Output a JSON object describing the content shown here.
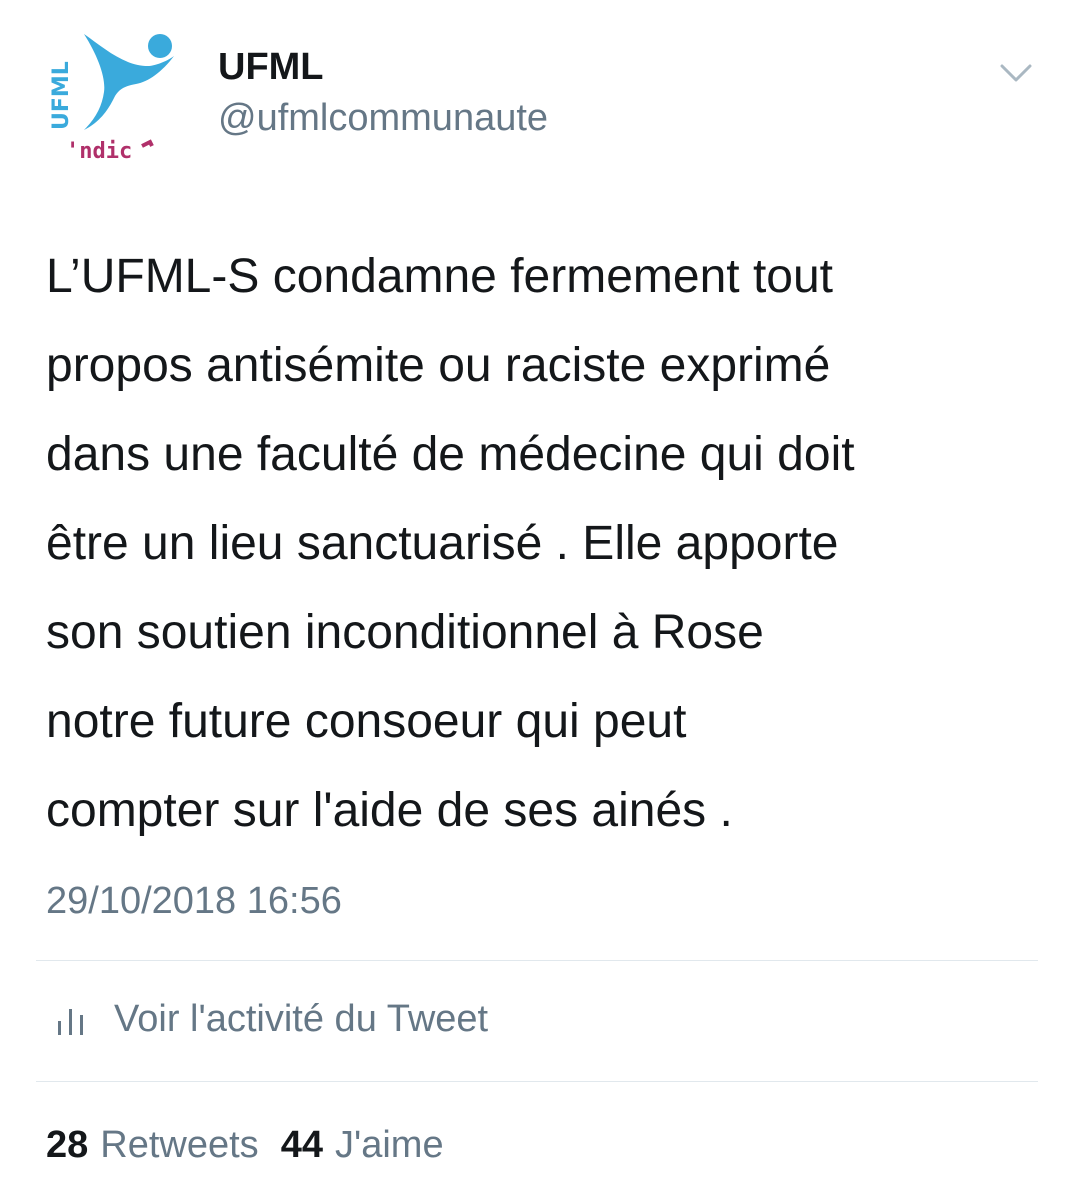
{
  "author": {
    "name": "UFML",
    "handle": "@ufmlcommunaute",
    "avatar_text": "UFML syndicat"
  },
  "tweet": {
    "lines": [
      "L’UFML-S condamne fermement tout",
      "propos antisémite ou raciste exprimé",
      "dans une faculté de médecine qui doit",
      "être un lieu sanctuarisé . Elle apporte",
      "son soutien inconditionnel à Rose",
      "notre future consoeur qui peut",
      "compter sur l'aide de ses ainés ."
    ],
    "timestamp": "29/10/2018 16:56"
  },
  "activity": {
    "icon": "bar-chart-icon",
    "label": "Voir l'activité du Tweet"
  },
  "stats": {
    "retweets_count": "28",
    "retweets_label": "Retweets",
    "likes_count": "44",
    "likes_label": "J'aime"
  },
  "colors": {
    "text": "#14171a",
    "secondary": "#657786",
    "divider": "#e1e8ed",
    "logo_blue": "#3aaadc",
    "logo_magenta": "#b0306a"
  }
}
